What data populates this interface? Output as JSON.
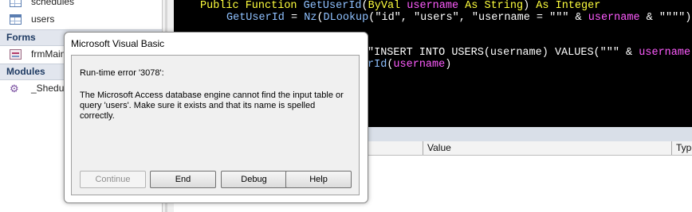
{
  "nav": {
    "items_top": [
      {
        "label": "schedules",
        "icon": "table-icon"
      },
      {
        "label": "users",
        "icon": "table-icon"
      }
    ],
    "group_forms": "Forms",
    "forms": [
      {
        "label": "frmMain",
        "icon": "form-icon"
      }
    ],
    "group_modules": "Modules",
    "modules": [
      {
        "label": "_Shedul",
        "icon": "module-icon"
      }
    ]
  },
  "code": {
    "line1": {
      "kw1": "Public Function ",
      "fn": "GetUserId",
      "p1": "(",
      "kw2": "ByVal ",
      "var": "username",
      "kw3": " As String",
      "p2": ")",
      "kw4": " As Integer"
    },
    "line2": {
      "fn": "GetUserId",
      "p1": " = ",
      "fn2": "Nz",
      "p2": "(",
      "fn3": "DLookup",
      "p3": "(",
      "s1": "\"id\"",
      "p4": ", ",
      "s2": "\"users\"",
      "p5": ", ",
      "s3": "\"username = \"\"\"",
      "p6": " & ",
      "var": "username",
      "p7": " & ",
      "s4": "\"\"\"\"",
      "p8": "))"
    },
    "line4_tail": {
      "s1": "\"INSERT INTO USERS(username) VALUES(\"\"\"",
      "p1": " & ",
      "var": "username",
      "p2": " &"
    },
    "line5_tail": {
      "fn": "rId",
      "p1": "(",
      "var": "username",
      "p2": ")"
    }
  },
  "locals": {
    "col_value": "Value",
    "col_type": "Type"
  },
  "dialog": {
    "title": "Microsoft Visual Basic",
    "error_line": "Run-time error '3078':",
    "message": "The Microsoft Access database engine cannot find the input table or query 'users'. Make sure it exists and that its name is spelled correctly.",
    "buttons": {
      "continue": "Continue",
      "end": "End",
      "debug": "Debug",
      "help": "Help"
    }
  }
}
